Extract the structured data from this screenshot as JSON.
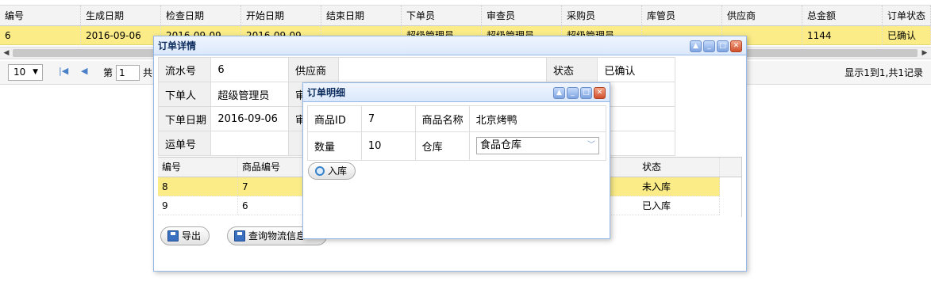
{
  "main_grid": {
    "columns": [
      "编号",
      "生成日期",
      "检查日期",
      "开始日期",
      "结束日期",
      "下单员",
      "审查员",
      "采购员",
      "库管员",
      "供应商",
      "总金额",
      "订单状态"
    ],
    "row": [
      "6",
      "2016-09-06",
      "2016-09-09",
      "2016-09-09",
      "",
      "超级管理员",
      "超级管理员",
      "超级管理员",
      "",
      "",
      "1144",
      "已确认"
    ]
  },
  "pager": {
    "page_size": "10",
    "page_label": "第",
    "page_value": "1",
    "page_of": "共",
    "info": "显示1到1,共1记录"
  },
  "detail_window": {
    "title": "订单详情",
    "fields": {
      "serial_label": "流水号",
      "serial_value": "6",
      "supplier_label": "供应商",
      "supplier_value": "",
      "status_label": "状态",
      "status_value": "已确认",
      "orderer_label": "下单人",
      "orderer_value": "超级管理员",
      "reviewer_label": "审",
      "order_date_label": "下单日期",
      "order_date_value": "2016-09-06",
      "review_label2": "审",
      "waybill_label": "运单号",
      "waybill_value": ""
    },
    "grid": {
      "columns": [
        "编号",
        "商品编号",
        "状态"
      ],
      "rows": [
        {
          "id": "8",
          "goods": "7",
          "status": "未入库"
        },
        {
          "id": "9",
          "goods": "6",
          "status": "已入库"
        }
      ]
    },
    "export_label": "导出",
    "logistics_label": "查询物流信息"
  },
  "item_window": {
    "title": "订单明细",
    "goods_id_label": "商品ID",
    "goods_id_value": "7",
    "goods_name_label": "商品名称",
    "goods_name_value": "北京烤鸭",
    "qty_label": "数量",
    "qty_value": "10",
    "store_label": "仓库",
    "store_value": "食品仓库",
    "inbound_label": "入库"
  }
}
